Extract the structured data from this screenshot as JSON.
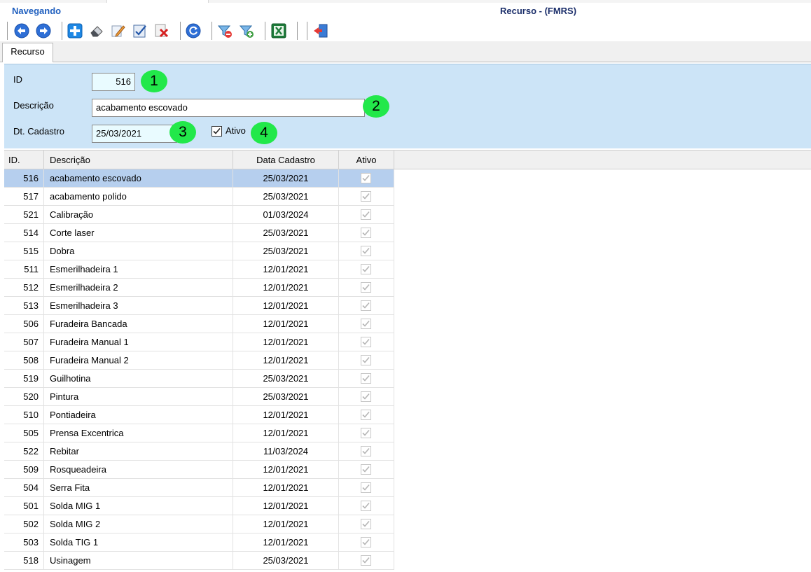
{
  "header": {
    "status": "Navegando",
    "title": "Recurso - (FMRS)"
  },
  "toolbar": {
    "buttons": [
      {
        "name": "prev-record-button",
        "icon": "arrow-left-icon"
      },
      {
        "name": "next-record-button",
        "icon": "arrow-right-icon"
      },
      {
        "name": "insert-button",
        "icon": "plus-icon"
      },
      {
        "name": "clear-button",
        "icon": "eraser-icon"
      },
      {
        "name": "edit-button",
        "icon": "pencil-icon"
      },
      {
        "name": "save-button",
        "icon": "checklist-icon"
      },
      {
        "name": "delete-button",
        "icon": "delete-x-icon"
      },
      {
        "name": "refresh-button",
        "icon": "refresh-icon"
      },
      {
        "name": "remove-filter-button",
        "icon": "filter-remove-icon"
      },
      {
        "name": "add-filter-button",
        "icon": "filter-add-icon"
      },
      {
        "name": "export-excel-button",
        "icon": "excel-icon"
      },
      {
        "name": "exit-button",
        "icon": "exit-door-icon"
      }
    ]
  },
  "tabs": [
    {
      "label": "Recurso"
    }
  ],
  "form": {
    "id_label": "ID",
    "id_value": "516",
    "desc_label": "Descrição",
    "desc_value": "acabamento escovado",
    "date_label": "Dt. Cadastro",
    "date_value": "25/03/2021",
    "active_label": "Ativo",
    "active_checked": true,
    "badges": [
      "1",
      "2",
      "3",
      "4"
    ]
  },
  "colors": {
    "panel": "#cce4f7",
    "selected_row": "#b6cfee",
    "badge": "#22e84a",
    "status_text": "#1f5fbf"
  },
  "grid": {
    "columns": [
      "ID.",
      "Descrição",
      "Data Cadastro",
      "Ativo"
    ],
    "selected_index": 0,
    "rows": [
      {
        "id": "516",
        "desc": "acabamento escovado",
        "date": "25/03/2021",
        "active": true
      },
      {
        "id": "517",
        "desc": "acabamento polido",
        "date": "25/03/2021",
        "active": true
      },
      {
        "id": "521",
        "desc": "Calibração",
        "date": "01/03/2024",
        "active": true
      },
      {
        "id": "514",
        "desc": "Corte laser",
        "date": "25/03/2021",
        "active": true
      },
      {
        "id": "515",
        "desc": "Dobra",
        "date": "25/03/2021",
        "active": true
      },
      {
        "id": "511",
        "desc": "Esmerilhadeira 1",
        "date": "12/01/2021",
        "active": true
      },
      {
        "id": "512",
        "desc": "Esmerilhadeira 2",
        "date": "12/01/2021",
        "active": true
      },
      {
        "id": "513",
        "desc": "Esmerilhadeira 3",
        "date": "12/01/2021",
        "active": true
      },
      {
        "id": "506",
        "desc": "Furadeira Bancada",
        "date": "12/01/2021",
        "active": true
      },
      {
        "id": "507",
        "desc": "Furadeira Manual 1",
        "date": "12/01/2021",
        "active": true
      },
      {
        "id": "508",
        "desc": "Furadeira Manual 2",
        "date": "12/01/2021",
        "active": true
      },
      {
        "id": "519",
        "desc": "Guilhotina",
        "date": "25/03/2021",
        "active": true
      },
      {
        "id": "520",
        "desc": "Pintura",
        "date": "25/03/2021",
        "active": true
      },
      {
        "id": "510",
        "desc": "Pontiadeira",
        "date": "12/01/2021",
        "active": true
      },
      {
        "id": "505",
        "desc": "Prensa Excentrica",
        "date": "12/01/2021",
        "active": true
      },
      {
        "id": "522",
        "desc": "Rebitar",
        "date": "11/03/2024",
        "active": true
      },
      {
        "id": "509",
        "desc": "Rosqueadeira",
        "date": "12/01/2021",
        "active": true
      },
      {
        "id": "504",
        "desc": "Serra Fita",
        "date": "12/01/2021",
        "active": true
      },
      {
        "id": "501",
        "desc": "Solda MIG 1",
        "date": "12/01/2021",
        "active": true
      },
      {
        "id": "502",
        "desc": "Solda MIG 2",
        "date": "12/01/2021",
        "active": true
      },
      {
        "id": "503",
        "desc": "Solda TIG 1",
        "date": "12/01/2021",
        "active": true
      },
      {
        "id": "518",
        "desc": "Usinagem",
        "date": "25/03/2021",
        "active": true
      }
    ]
  }
}
